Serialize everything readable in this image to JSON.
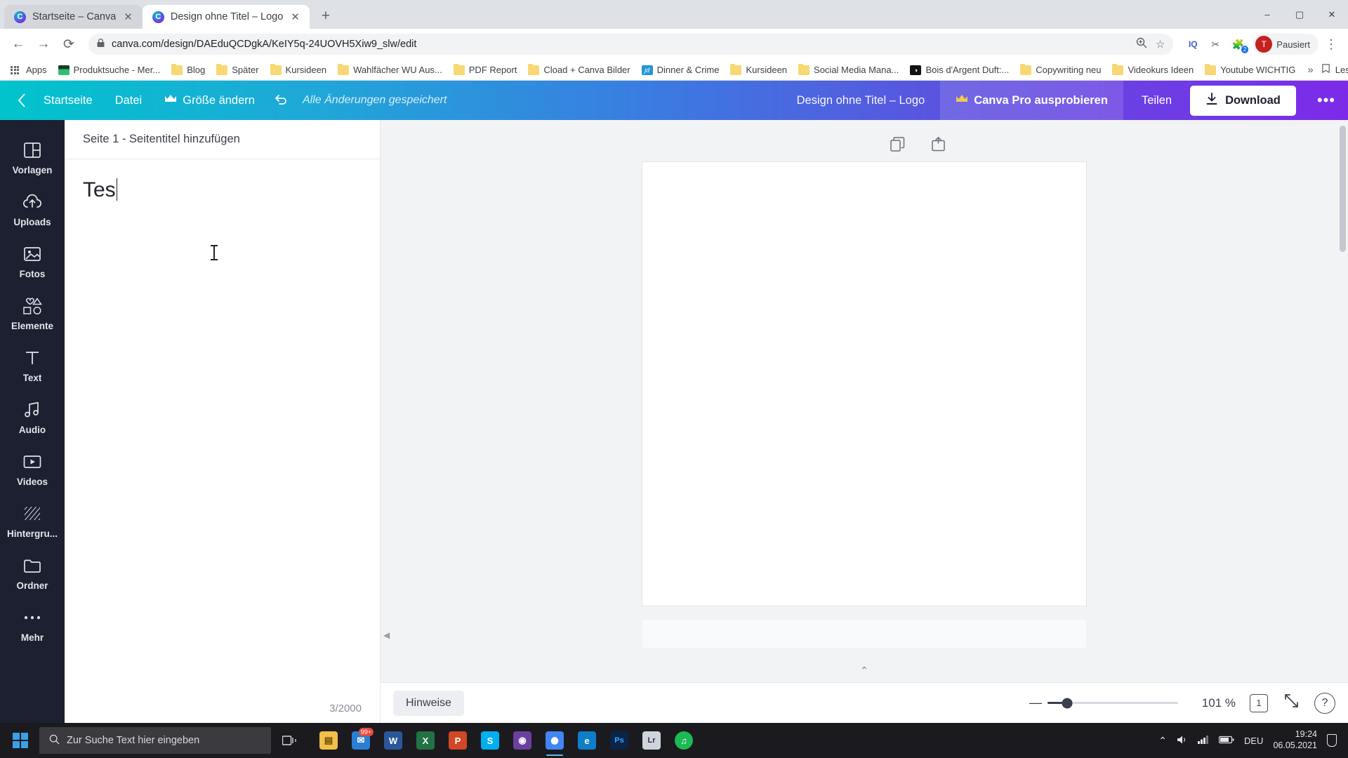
{
  "browser": {
    "tabs": [
      {
        "title": "Startseite – Canva",
        "favicon": "canva-icon",
        "active": false
      },
      {
        "title": "Design ohne Titel – Logo",
        "favicon": "canva-icon",
        "active": true
      }
    ],
    "new_tab_label": "+",
    "window_controls": {
      "minimize": "–",
      "maximize": "▢",
      "close": "✕"
    },
    "nav": {
      "back": "←",
      "forward": "→",
      "reload": "⟳"
    },
    "omnibox": {
      "lock": "🔒",
      "url": "canva.com/design/DAEduQCDgkA/KeIY5q-24UOVH5Xiw9_slw/edit",
      "zoom_icon": "search-plus-icon",
      "star_icon": "☆"
    },
    "extensions": [
      {
        "name": "iq-extension",
        "glyph": "IQ"
      },
      {
        "name": "pin-extension",
        "glyph": "✂"
      },
      {
        "name": "puzzle-extension",
        "glyph": "🧩",
        "badge": "2"
      }
    ],
    "profile": {
      "initial": "T",
      "label": "Pausiert"
    },
    "menu": "⋮",
    "bookmarks": [
      {
        "label": "Apps",
        "icon": "apps-grid-icon"
      },
      {
        "label": "Produktsuche - Mer...",
        "icon": "site-icon-green"
      },
      {
        "label": "Blog",
        "icon": "folder-icon"
      },
      {
        "label": "Später",
        "icon": "folder-icon"
      },
      {
        "label": "Kursideen",
        "icon": "folder-icon"
      },
      {
        "label": "Wahlfächer WU Aus...",
        "icon": "folder-icon"
      },
      {
        "label": "PDF Report",
        "icon": "folder-icon"
      },
      {
        "label": "Cload + Canva Bilder",
        "icon": "folder-icon"
      },
      {
        "label": "Dinner & Crime",
        "icon": "site-icon-blue",
        "glyph": "jd"
      },
      {
        "label": "Kursideen",
        "icon": "folder-icon"
      },
      {
        "label": "Social Media Mana...",
        "icon": "folder-icon"
      },
      {
        "label": "Bois d'Argent Duft:...",
        "icon": "site-icon-black",
        "glyph": "◑"
      },
      {
        "label": "Copywriting neu",
        "icon": "folder-icon"
      },
      {
        "label": "Videokurs Ideen",
        "icon": "folder-icon"
      },
      {
        "label": "Youtube WICHTIG",
        "icon": "folder-icon"
      }
    ],
    "bookmarks_overflow": "»",
    "reading_list": {
      "label": "Leseliste",
      "icon": "reading-list-icon"
    }
  },
  "canva": {
    "header": {
      "back_icon": "chevron-left-icon",
      "home": "Startseite",
      "file": "Datei",
      "resize": "Größe ändern",
      "resize_icon": "crown-icon",
      "undo_icon": "undo-arrow-icon",
      "saved_status": "Alle Änderungen gespeichert",
      "design_title": "Design ohne Titel – Logo",
      "pro_label": "Canva Pro ausprobieren",
      "pro_icon": "crown-icon",
      "share": "Teilen",
      "download": "Download",
      "download_icon": "download-arrow-icon",
      "more": "•••"
    },
    "rail": [
      {
        "label": "Vorlagen",
        "icon": "templates-icon"
      },
      {
        "label": "Uploads",
        "icon": "upload-cloud-icon"
      },
      {
        "label": "Fotos",
        "icon": "photo-icon"
      },
      {
        "label": "Elemente",
        "icon": "shapes-icon"
      },
      {
        "label": "Text",
        "icon": "text-t-icon"
      },
      {
        "label": "Audio",
        "icon": "music-note-icon"
      },
      {
        "label": "Videos",
        "icon": "video-play-icon"
      },
      {
        "label": "Hintergru...",
        "icon": "background-pattern-icon"
      },
      {
        "label": "Ordner",
        "icon": "folder-icon"
      },
      {
        "label": "Mehr",
        "icon": "more-dots-icon"
      }
    ],
    "text_panel": {
      "page_header": "Seite 1 - Seitentitel hinzufügen",
      "content": "Tes",
      "char_counter": "3/2000"
    },
    "canvas": {
      "duplicate_page_icon": "duplicate-page-icon",
      "add_page_icon": "add-page-icon",
      "collapse_icon": "chevron-up-icon"
    },
    "bottom_bar": {
      "notes": "Hinweise",
      "zoom_minus": "—",
      "zoom_percent": "101 %",
      "page_count": "1",
      "fullscreen_icon": "expand-icon",
      "help_icon": "question-mark-icon"
    }
  },
  "taskbar": {
    "start_icon": "windows-start-icon",
    "search_placeholder": "Zur Suche Text hier eingeben",
    "search_icon": "search-icon",
    "task_view_icon": "task-view-icon",
    "apps": [
      {
        "name": "file-explorer",
        "glyph": "📁",
        "color": "#f0c04a"
      },
      {
        "name": "mail",
        "glyph": "✉",
        "color": "#2a7fd4",
        "badge": "99+"
      },
      {
        "name": "word",
        "glyph": "W",
        "color": "#2b579a"
      },
      {
        "name": "excel",
        "glyph": "X",
        "color": "#217346"
      },
      {
        "name": "powerpoint",
        "glyph": "P",
        "color": "#d24726"
      },
      {
        "name": "skype",
        "glyph": "S",
        "color": "#00aff0"
      },
      {
        "name": "media-player",
        "glyph": "◉",
        "color": "#6b3fa0"
      },
      {
        "name": "chrome",
        "glyph": "◎",
        "color": "#4285f4",
        "active": true
      },
      {
        "name": "edge",
        "glyph": "e",
        "color": "#0f7ec8"
      },
      {
        "name": "photoshop",
        "glyph": "Ps",
        "color": "#31a8ff"
      },
      {
        "name": "lightroom",
        "glyph": "Lr",
        "color": "#cfd4dc"
      },
      {
        "name": "spotify",
        "glyph": "♫",
        "color": "#1db954"
      }
    ],
    "tray": {
      "chevron": "⌃",
      "volume_icon": "volume-icon",
      "network_icon": "network-icon",
      "battery_icon": "battery-icon",
      "language": "DEU",
      "time": "19:24",
      "date": "06.05.2021",
      "notifications_icon": "notification-icon"
    }
  },
  "colors": {
    "canva_gradient_start": "#00c4cc",
    "canva_gradient_end": "#7d2ae8",
    "rail_bg": "#1c2030",
    "accent_blue": "#1a73e8",
    "taskbar_bg": "#1b1b1f"
  }
}
